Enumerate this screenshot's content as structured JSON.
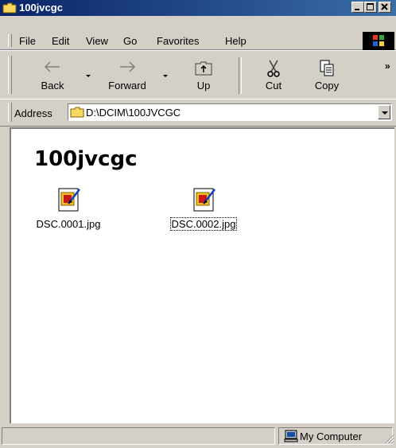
{
  "window": {
    "title": "100jvcgc"
  },
  "menu": {
    "items": [
      {
        "label": "File"
      },
      {
        "label": "Edit"
      },
      {
        "label": "View"
      },
      {
        "label": "Go"
      },
      {
        "label": "Favorites"
      },
      {
        "label": "Help"
      }
    ]
  },
  "toolbar": {
    "back_label": "Back",
    "forward_label": "Forward",
    "up_label": "Up",
    "cut_label": "Cut",
    "copy_label": "Copy",
    "more_label": "»"
  },
  "address": {
    "label": "Address",
    "value": "D:\\DCIM\\100JVCGC"
  },
  "content": {
    "heading": "100jvcgc",
    "files": [
      {
        "name": "DSC.0001.jpg",
        "selected": false
      },
      {
        "name": "DSC.0002.jpg",
        "selected": true
      }
    ]
  },
  "status": {
    "zone": "My Computer"
  },
  "colors": {
    "title_active": "#0a246a",
    "title_gradient_end": "#3a6ea5",
    "chrome": "#d4d0c8"
  }
}
